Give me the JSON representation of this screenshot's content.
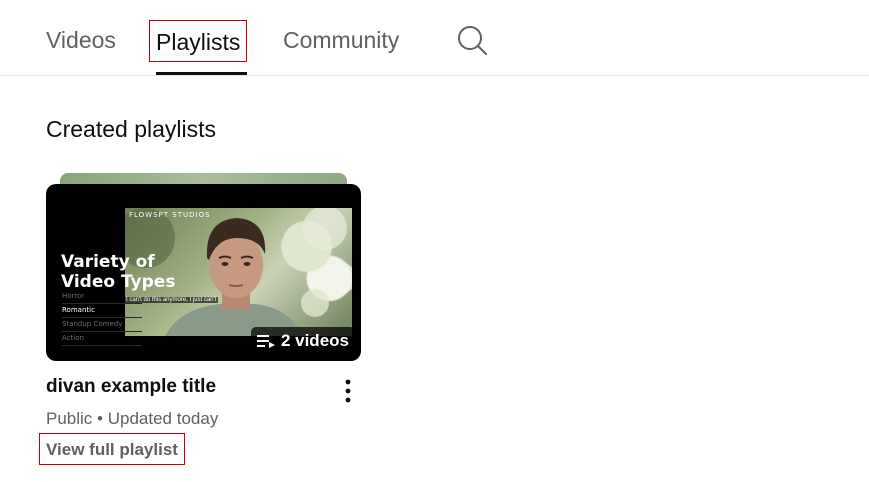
{
  "tabs": [
    {
      "label": "Videos",
      "selected": false
    },
    {
      "label": "Playlists",
      "selected": true
    },
    {
      "label": "Community",
      "selected": false
    }
  ],
  "search": {
    "icon": "search-icon"
  },
  "section": {
    "title": "Created playlists"
  },
  "playlist": {
    "thumbnail": {
      "studio_logo": "FLOWSPT STUDIOS",
      "title_line_1": "Variety of",
      "title_line_2": "Video Types",
      "genres": [
        "Horror",
        "Romantic",
        "Standup Comedy",
        "Action"
      ],
      "active_genre": "Romantic",
      "subtitle": "I can't do this anymore, I just can't",
      "video_count": "2 videos",
      "count_icon": "playlist-icon"
    },
    "title": "divan example title",
    "visibility": "Public",
    "separator": "•",
    "updated": "Updated today",
    "view_full_label": "View full playlist",
    "more_icon": "more-vert-icon"
  },
  "colors": {
    "text_primary": "#0f0f0f",
    "text_secondary": "#606060",
    "highlight_border": "#cc0000",
    "divider": "#e5e5e5"
  }
}
